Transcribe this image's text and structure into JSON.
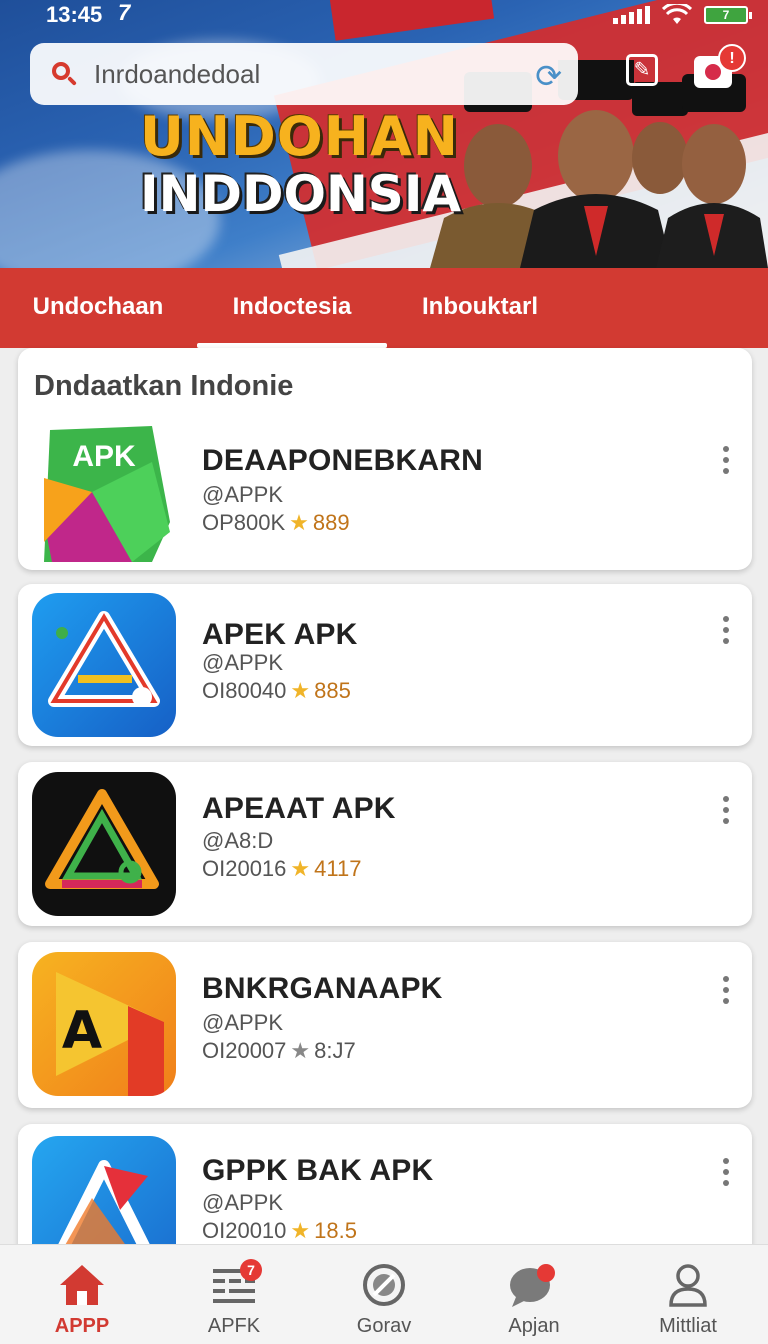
{
  "status": {
    "time": "13:45",
    "extra": "7",
    "battery": "7"
  },
  "search": {
    "placeholder": "Inrdoandedoal",
    "value": "Inrdoandedoal"
  },
  "header": {
    "camera_badge": "!"
  },
  "banner": {
    "line1": "UNDOHAN",
    "line2": "INDDONSIA"
  },
  "tabs": [
    {
      "label": "Undochaan",
      "active": false
    },
    {
      "label": "Indoctesia",
      "active": true
    },
    {
      "label": "Inbouktarl",
      "active": false
    }
  ],
  "section": {
    "title": "Dndaatkan Indonie"
  },
  "apps": [
    {
      "name": "DEAAPONEBKARN",
      "developer": "@APPK",
      "downloads": "OP800K",
      "rating": "889",
      "star_color": "gold",
      "icon_text": "APK",
      "icon_name": "apk-green-icon"
    },
    {
      "name": "APEK APK",
      "developer": "@APPK",
      "downloads": "OI80040",
      "rating": "885",
      "star_color": "gold",
      "icon_text": "",
      "icon_name": "apek-blue-icon"
    },
    {
      "name": "APEAAT APK",
      "developer": "@A8:D",
      "downloads": "OI20016",
      "rating": "4117",
      "star_color": "gold",
      "icon_text": "",
      "icon_name": "apeaat-dark-icon"
    },
    {
      "name": "BNKRGANAAPK",
      "developer": "@APPK",
      "downloads": "OI20007",
      "rating": "8:J7",
      "star_color": "grey",
      "icon_text": "A",
      "icon_name": "bnkrgan-orange-icon"
    },
    {
      "name": "GPPK BAK APK",
      "developer": "@APPK",
      "downloads": "OI20010",
      "rating": "18.5",
      "star_color": "gold",
      "icon_text": "",
      "icon_name": "gppk-blue-icon"
    }
  ],
  "nav": [
    {
      "label": "APPP",
      "active": true
    },
    {
      "label": "APFK",
      "badge": "7"
    },
    {
      "label": "Gorav"
    },
    {
      "label": "Apjan"
    },
    {
      "label": "Mittliat"
    }
  ],
  "colors": {
    "accent": "#d23a32",
    "star": "#f0b429",
    "rating": "#c0741a"
  }
}
